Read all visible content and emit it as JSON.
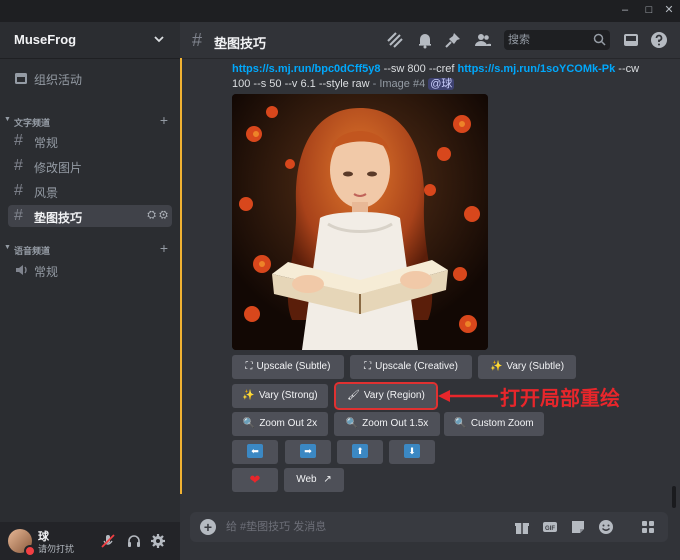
{
  "window": {
    "minimize": "–",
    "maximize": "□",
    "close": "✕"
  },
  "server": {
    "name": "MuseFrog"
  },
  "sidebar": {
    "event_label": "组织活动",
    "text_category": "文字频道",
    "voice_category": "语音频道",
    "channels": [
      {
        "label": "常规"
      },
      {
        "label": "修改图片"
      },
      {
        "label": "风景"
      },
      {
        "label": "垫图技巧"
      }
    ],
    "voice_channels": [
      {
        "label": "常规"
      }
    ]
  },
  "user": {
    "name": "球",
    "status": "请勿打扰"
  },
  "topbar": {
    "channel_title": "垫图技巧",
    "search_placeholder": "搜索"
  },
  "message": {
    "link1": "https://s.mj.run/bpc0dCff5y8",
    "text1": " --sw 800 --cref ",
    "link2": "https://s.mj.run/1soYCOMk-Pk",
    "text2": " --cw 100 --s 50 --v 6.1 --style raw",
    "meta": " - Image #4 ",
    "mention": "@球"
  },
  "buttons": {
    "upscale_subtle": "Upscale (Subtle)",
    "upscale_creative": "Upscale (Creative)",
    "vary_subtle": "Vary (Subtle)",
    "vary_strong": "Vary (Strong)",
    "vary_region": "Vary (Region)",
    "zoom_out_2x": "Zoom Out 2x",
    "zoom_out_15x": "Zoom Out 1.5x",
    "custom_zoom": "Custom Zoom",
    "pan_left": "⬅",
    "pan_right": "➡",
    "pan_up": "⬆",
    "pan_down": "⬇",
    "favorite": "❤",
    "web": "Web"
  },
  "annotation": {
    "text": "打开局部重绘",
    "color": "#e8262b"
  },
  "composer": {
    "placeholder": "给 #垫图技巧 发消息",
    "add": "+"
  },
  "colors": {
    "accent": "#f0b232",
    "link": "#00a8fc",
    "highlight": "#e03131"
  }
}
